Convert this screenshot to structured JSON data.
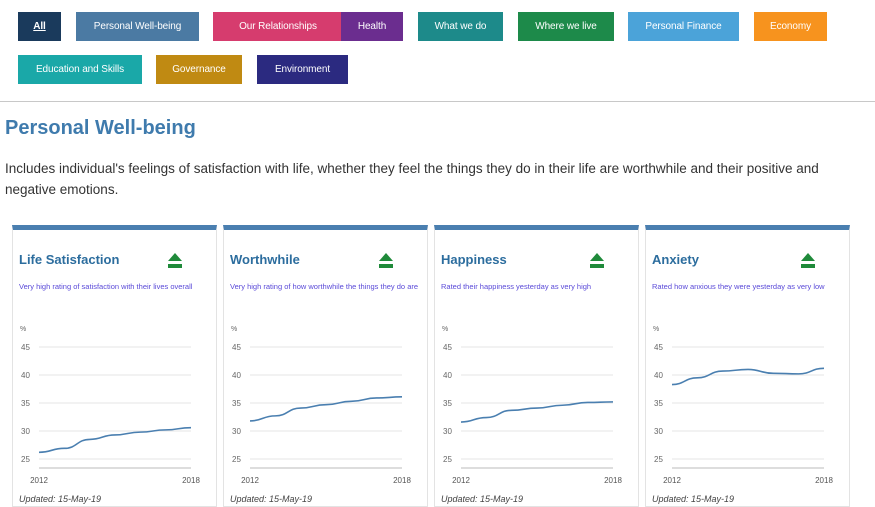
{
  "filters": [
    {
      "label": "All",
      "color": "#1a3a5c",
      "active": true
    },
    {
      "label": "Personal Well-being",
      "color": "#4b7aa3"
    },
    {
      "label": "Our Relationships",
      "color": "#d63c6e"
    },
    {
      "label": "Health",
      "color": "#6b2d8f"
    },
    {
      "label": "What we do",
      "color": "#1d8a8a"
    },
    {
      "label": "Where we live",
      "color": "#1d8a4a"
    },
    {
      "label": "Personal Finance",
      "color": "#4ba3d9"
    },
    {
      "label": "Economy",
      "color": "#f7931e"
    },
    {
      "label": "Education and Skills",
      "color": "#1aa8a8"
    },
    {
      "label": "Governance",
      "color": "#c08a12"
    },
    {
      "label": "Environment",
      "color": "#2b2a80"
    }
  ],
  "section": {
    "title": "Personal Well-being",
    "description": "Includes individual's feelings of satisfaction with life, whether they feel the things they do in their life are worthwhile and their positive and negative emotions."
  },
  "cards": [
    {
      "title": "Life Satisfaction",
      "description": "Very high rating of satisfaction with their lives overall",
      "trend_icon": "up-arrow-icon",
      "updated": "Updated: 15-May-19",
      "chart_data": {
        "type": "line",
        "unit": "%",
        "x": [
          2012,
          2013,
          2014,
          2015,
          2016,
          2017,
          2018
        ],
        "values": [
          26.2,
          26.9,
          28.5,
          29.3,
          29.8,
          30.2,
          30.6
        ],
        "ylim": [
          25,
          45
        ],
        "y_ticks": [
          25,
          30,
          35,
          40,
          45
        ],
        "x_labels": [
          "2012",
          "2018"
        ]
      }
    },
    {
      "title": "Worthwhile",
      "description": "Very high rating of how worthwhile the things they do are",
      "trend_icon": "up-arrow-icon",
      "updated": "Updated: 15-May-19",
      "chart_data": {
        "type": "line",
        "unit": "%",
        "x": [
          2012,
          2013,
          2014,
          2015,
          2016,
          2017,
          2018
        ],
        "values": [
          31.8,
          32.7,
          34.1,
          34.7,
          35.3,
          35.9,
          36.1
        ],
        "ylim": [
          25,
          45
        ],
        "y_ticks": [
          25,
          30,
          35,
          40,
          45
        ],
        "x_labels": [
          "2012",
          "2018"
        ]
      }
    },
    {
      "title": "Happiness",
      "description": "Rated their happiness yesterday as very high",
      "trend_icon": "up-arrow-icon",
      "updated": "Updated: 15-May-19",
      "chart_data": {
        "type": "line",
        "unit": "%",
        "x": [
          2012,
          2013,
          2014,
          2015,
          2016,
          2017,
          2018
        ],
        "values": [
          31.6,
          32.4,
          33.7,
          34.1,
          34.6,
          35.1,
          35.2
        ],
        "ylim": [
          25,
          45
        ],
        "y_ticks": [
          25,
          30,
          35,
          40,
          45
        ],
        "x_labels": [
          "2012",
          "2018"
        ]
      }
    },
    {
      "title": "Anxiety",
      "description": "Rated how anxious they were yesterday as very low",
      "trend_icon": "up-arrow-icon",
      "updated": "Updated: 15-May-19",
      "chart_data": {
        "type": "line",
        "unit": "%",
        "x": [
          2012,
          2013,
          2014,
          2015,
          2016,
          2017,
          2018
        ],
        "values": [
          38.3,
          39.5,
          40.7,
          41.0,
          40.3,
          40.2,
          41.2
        ],
        "ylim": [
          25,
          45
        ],
        "y_ticks": [
          25,
          30,
          35,
          40,
          45
        ],
        "x_labels": [
          "2012",
          "2018"
        ]
      }
    }
  ]
}
